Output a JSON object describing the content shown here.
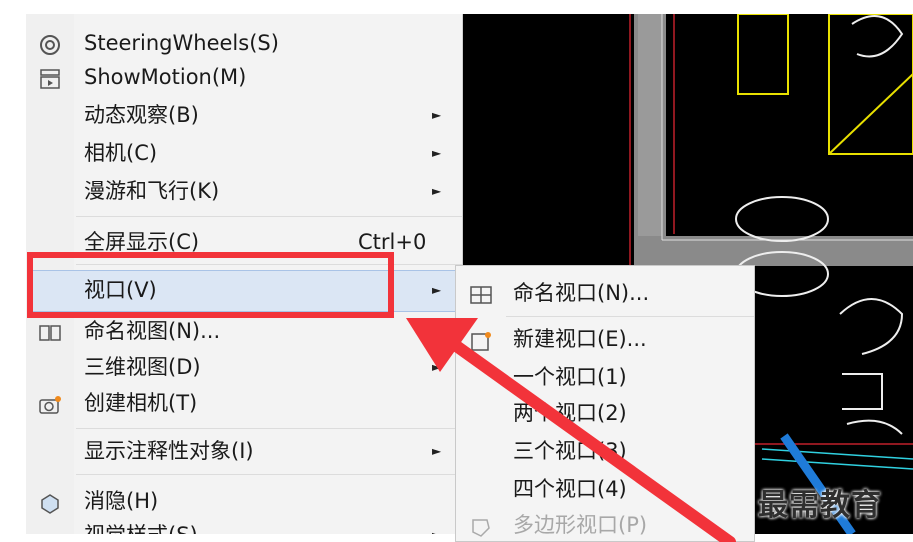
{
  "menu": {
    "items": [
      {
        "label": "SteeringWheels(S)",
        "icon": "steering-wheel-icon"
      },
      {
        "label": "ShowMotion(M)",
        "icon": "showmotion-icon"
      },
      {
        "label": "动态观察(B)",
        "submenu": true
      },
      {
        "label": "相机(C)",
        "submenu": true
      },
      {
        "label": "漫游和飞行(K)",
        "submenu": true
      },
      {
        "label": "全屏显示(C)",
        "shortcut": "Ctrl+0"
      },
      {
        "label": "视口(V)",
        "submenu": true,
        "highlighted": true
      },
      {
        "label": "命名视图(N)...",
        "icon": "named-view-icon"
      },
      {
        "label": "三维视图(D)",
        "submenu": true
      },
      {
        "label": "创建相机(T)",
        "icon": "camera-icon"
      },
      {
        "label": "显示注释性对象(I)",
        "submenu": true
      },
      {
        "label": "消隐(H)",
        "icon": "hide-icon"
      },
      {
        "label": "视觉样式(S)",
        "submenu": true
      }
    ]
  },
  "submenu": {
    "items": [
      {
        "label": "命名视口(N)...",
        "icon": "named-viewport-icon"
      },
      {
        "label": "新建视口(E)...",
        "icon": "new-viewport-icon"
      },
      {
        "label": "一个视口(1)"
      },
      {
        "label": "两个视口(2)"
      },
      {
        "label": "三个视口(3)"
      },
      {
        "label": "四个视口(4)"
      },
      {
        "label": "多边形视口(P)",
        "disabled": true,
        "icon": "polygon-viewport-icon"
      }
    ]
  },
  "watermark": "最需教育",
  "colors": {
    "highlight_box": "#f2333a",
    "canvas": "#000000",
    "accent_blue": "#1f7bd8"
  }
}
